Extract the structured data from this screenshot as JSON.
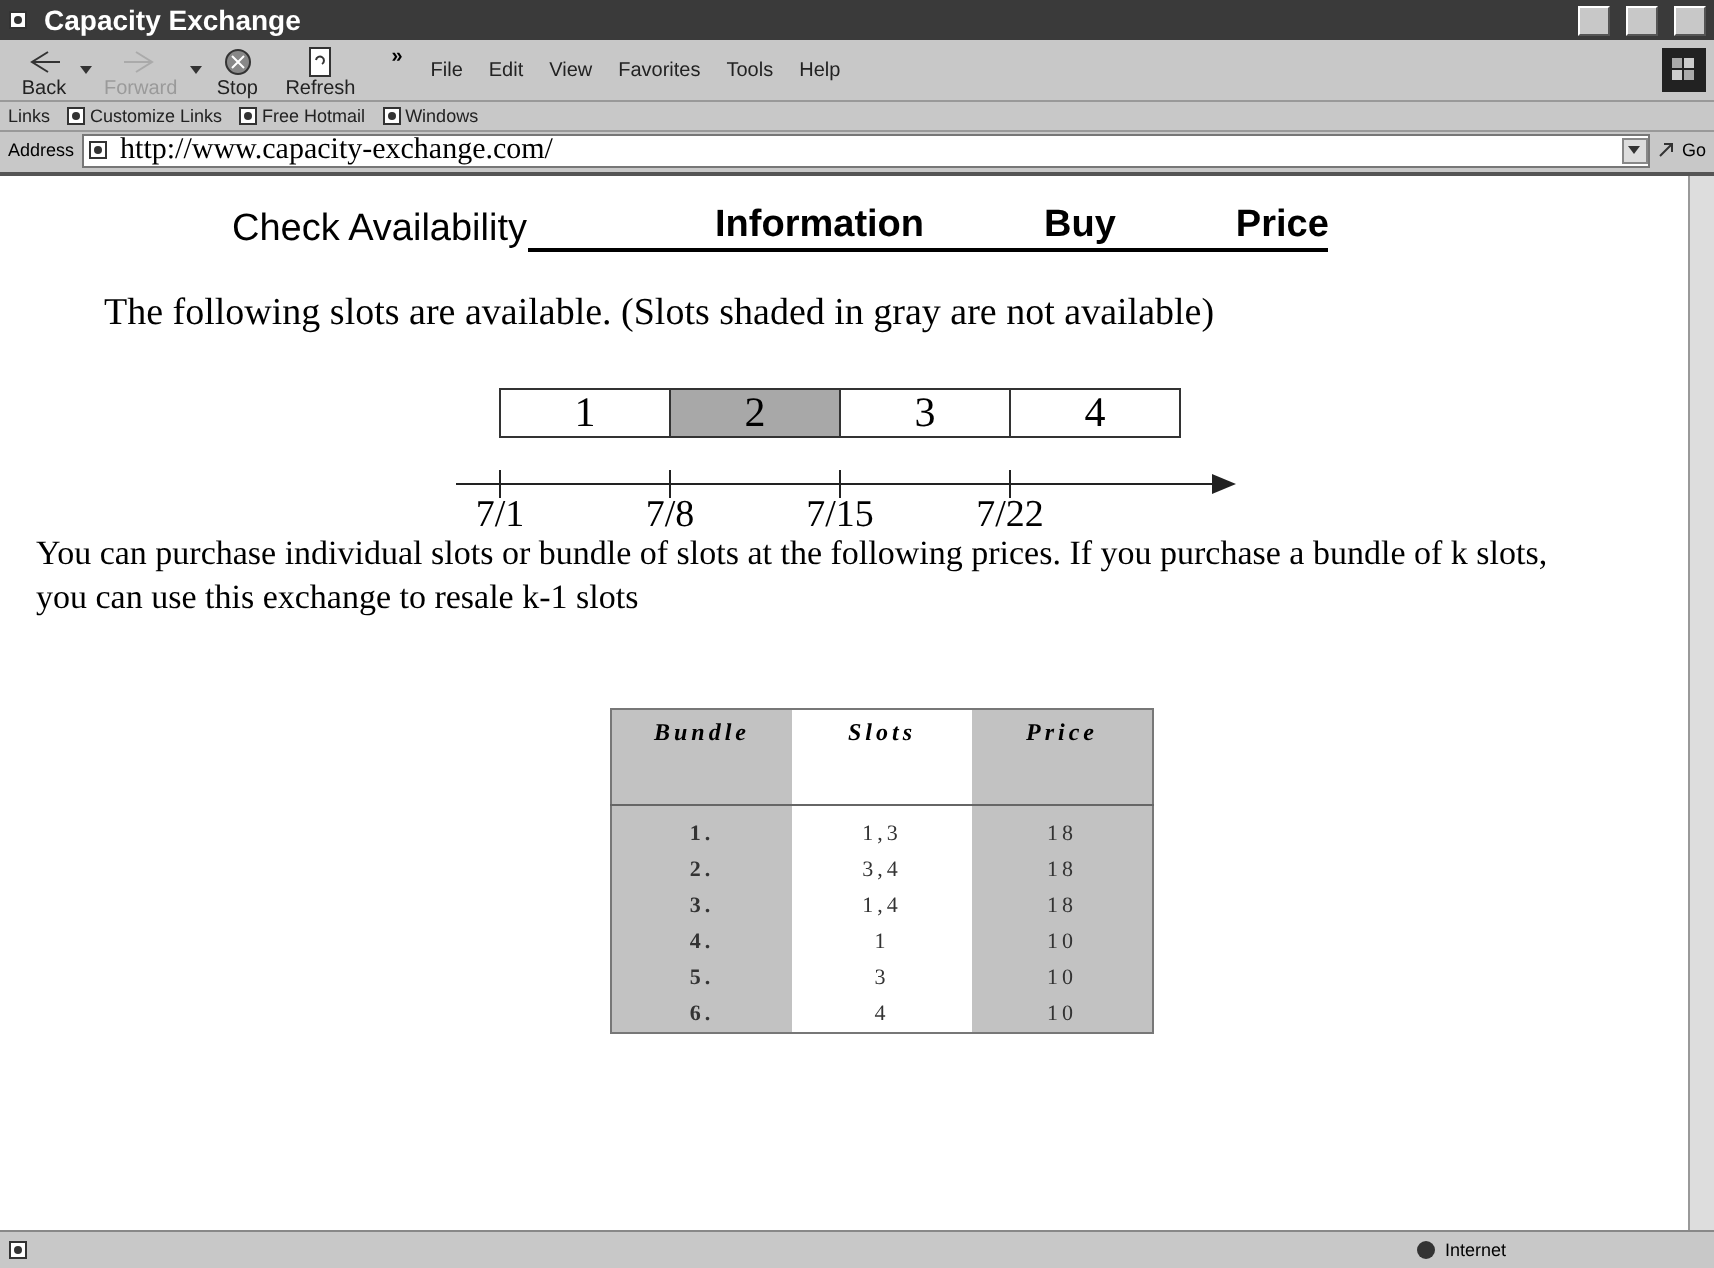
{
  "window": {
    "title": "Capacity Exchange"
  },
  "toolbar": {
    "buttons": [
      {
        "label": "Back",
        "kind": "back",
        "disabled": false
      },
      {
        "label": "Forward",
        "kind": "forward",
        "disabled": true
      },
      {
        "label": "Stop",
        "kind": "stop",
        "disabled": false
      },
      {
        "label": "Refresh",
        "kind": "refresh",
        "disabled": false
      }
    ],
    "overflow": "»"
  },
  "menu": [
    "File",
    "Edit",
    "View",
    "Favorites",
    "Tools",
    "Help"
  ],
  "links_bar": {
    "label": "Links",
    "items": [
      "Customize Links",
      "Free Hotmail",
      "Windows"
    ]
  },
  "address_bar": {
    "label": "Address",
    "value": "http://www.capacity-exchange.com/",
    "go": "Go"
  },
  "nav": [
    {
      "label": "Check Availability",
      "selected": true
    },
    {
      "label": "Information",
      "selected": false
    },
    {
      "label": "Buy",
      "selected": false
    },
    {
      "label": "Price",
      "selected": false
    }
  ],
  "intro": "The following slots are available. (Slots shaded in gray are not available)",
  "slots": [
    {
      "label": "1",
      "available": true
    },
    {
      "label": "2",
      "available": false
    },
    {
      "label": "3",
      "available": true
    },
    {
      "label": "4",
      "available": true
    }
  ],
  "dates": [
    "7/1",
    "7/8",
    "7/15",
    "7/22"
  ],
  "description": "You can purchase individual slots or bundle of slots at the following prices. If you purchase a bundle of k slots, you can use this exchange to resale k-1 slots",
  "table": {
    "columns": [
      "Bundle",
      "Slots",
      "Price"
    ],
    "rows": [
      [
        "1.",
        "1,3",
        "18"
      ],
      [
        "2.",
        "3,4",
        "18"
      ],
      [
        "3.",
        "1,4",
        "18"
      ],
      [
        "4.",
        "1",
        "10"
      ],
      [
        "5.",
        "3",
        "10"
      ],
      [
        "6.",
        "4",
        "10"
      ]
    ]
  },
  "status_bar": {
    "zone": "Internet"
  }
}
